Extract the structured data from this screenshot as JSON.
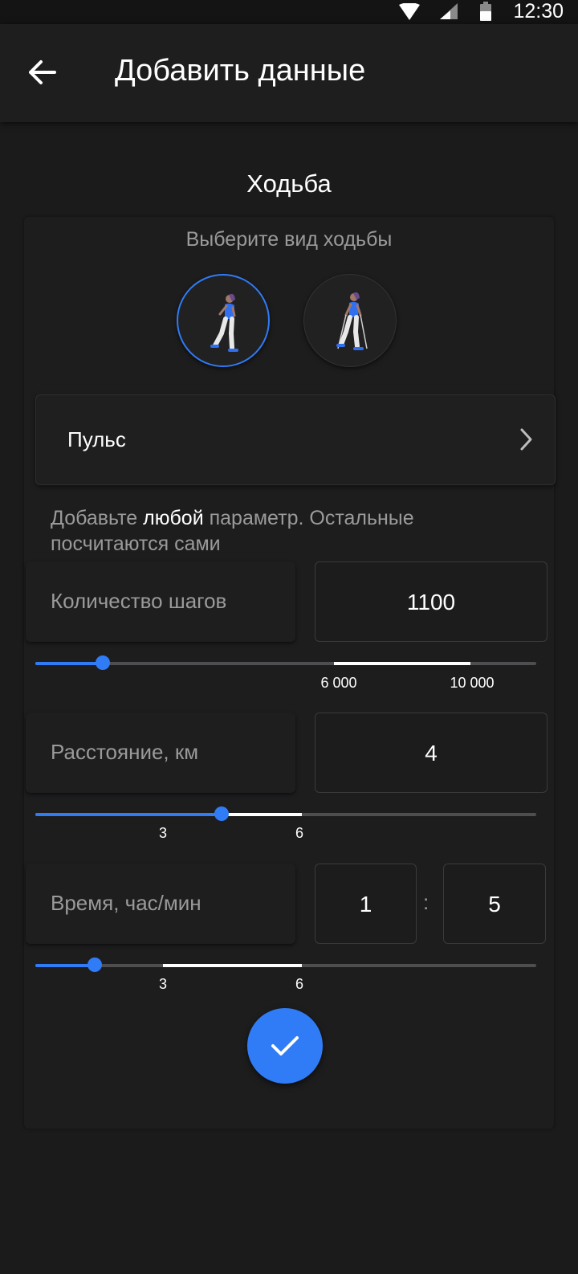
{
  "status_bar": {
    "time": "12:30"
  },
  "header": {
    "title": "Добавить данные"
  },
  "section": {
    "title": "Ходьба",
    "prompt": "Выберите вид ходьбы",
    "walk_types": [
      {
        "icon": "walking-person-icon",
        "selected": true
      },
      {
        "icon": "nordic-walking-person-icon",
        "selected": false
      }
    ]
  },
  "pulse": {
    "label": "Пульс"
  },
  "hint": {
    "before": "Добавьте ",
    "emphasis": "любой",
    "after": " параметр. Остальные посчитаются сами"
  },
  "steps": {
    "label": "Количество шагов",
    "value": "1100",
    "slider_fraction": 0.134,
    "ticks": [
      "6 000",
      "10 000"
    ]
  },
  "distance": {
    "label": "Расстояние, км",
    "value": "4",
    "slider_fraction": 0.372,
    "ticks": [
      "3",
      "6"
    ]
  },
  "time": {
    "label": "Время, час/мин",
    "hours": "1",
    "separator": ":",
    "minutes": "5",
    "slider_fraction": 0.118,
    "ticks": [
      "3",
      "6"
    ]
  },
  "colors": {
    "accent": "#2f7cf6",
    "background": "#1b1b1c",
    "muted_text": "#9a9a9a"
  }
}
